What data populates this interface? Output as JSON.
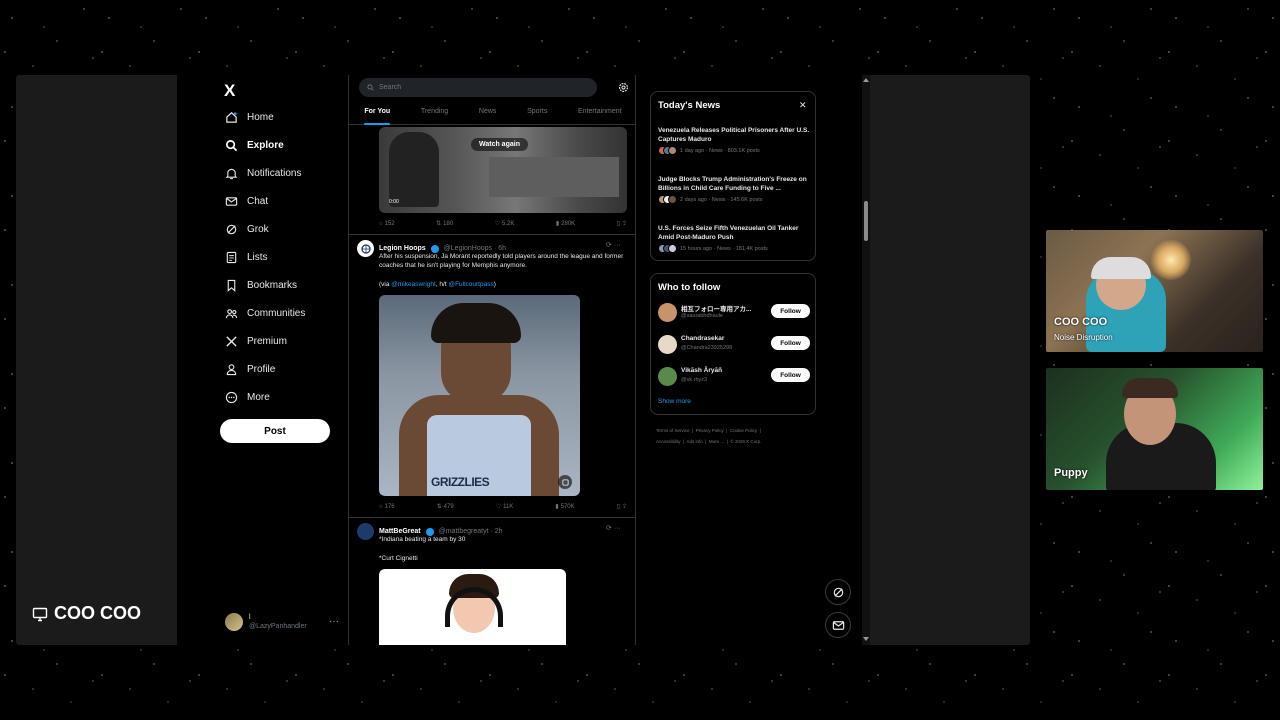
{
  "presenter": {
    "name": "COO COO"
  },
  "nav": {
    "logo": "X",
    "items": [
      {
        "label": "Home",
        "icon": "home-icon"
      },
      {
        "label": "Explore",
        "icon": "search-icon"
      },
      {
        "label": "Notifications",
        "icon": "bell-icon"
      },
      {
        "label": "Chat",
        "icon": "mail-icon"
      },
      {
        "label": "Grok",
        "icon": "grok-icon"
      },
      {
        "label": "Lists",
        "icon": "list-icon"
      },
      {
        "label": "Bookmarks",
        "icon": "bookmark-icon"
      },
      {
        "label": "Communities",
        "icon": "people-icon"
      },
      {
        "label": "Premium",
        "icon": "x-icon"
      },
      {
        "label": "Profile",
        "icon": "person-icon"
      },
      {
        "label": "More",
        "icon": "more-icon"
      }
    ],
    "active": "Explore",
    "post_label": "Post",
    "account": {
      "name": "l",
      "handle": "@LazyPanhandler"
    }
  },
  "feed": {
    "search_placeholder": "Search",
    "tabs": [
      "For You",
      "Trending",
      "News",
      "Sports",
      "Entertainment"
    ],
    "active_tab": "For You",
    "video": {
      "overlay": "Watch again",
      "timecode": "0:00"
    },
    "stats1": {
      "replies": "152",
      "reposts": "180",
      "likes": "5.2K",
      "views": "280K"
    },
    "tweet1": {
      "name": "Legion Hoops",
      "handle": "@LegionHoops · 6h",
      "text": "After his suspension, Ja Morant reportedly told players around the league and former coaches that he isn't playing for Memphis anymore.",
      "via_prefix": "(via ",
      "via_link1": "@mikeaswright",
      "via_mid": ", h/t ",
      "via_link2": "@Fullcourtpass",
      "via_suffix": ")",
      "jersey_text": "GRIZZLIES"
    },
    "stats2": {
      "replies": "176",
      "reposts": "479",
      "likes": "11K",
      "views": "570K"
    },
    "tweet2": {
      "name": "MattBeGreat",
      "handle": "@mattbegreatyt · 2h",
      "line1": "*Indiana beating a team by 30",
      "line2": "*Curt Cignetti"
    }
  },
  "news": {
    "title": "Today's News",
    "items": [
      {
        "headline": "Venezuela Releases Political Prisoners After U.S. Captures Maduro",
        "meta": "1 day ago · News · 803.1K posts"
      },
      {
        "headline": "Judge Blocks Trump Administration's Freeze on Billions in Child Care Funding to Five ...",
        "meta": "2 days ago · News · 145.6K posts"
      },
      {
        "headline": "U.S. Forces Seize Fifth Venezuelan Oil Tanker Amid Post-Maduro Push",
        "meta": "15 hours ago · News · 181.4K posts"
      }
    ]
  },
  "who_to_follow": {
    "title": "Who to follow",
    "accounts": [
      {
        "name": "相互フォロー専用アカ...",
        "handle": "@saurabhdhaule"
      },
      {
        "name": "Chandrasekar",
        "handle": "@Chandra23925298"
      },
      {
        "name": "Vikāsh Āryāñ",
        "handle": "@vk.rhyz3"
      }
    ],
    "follow_label": "Follow",
    "show_more": "Show more"
  },
  "footer": {
    "links": [
      "Terms of Service",
      "Privacy Policy",
      "Cookie Policy",
      "Accessibility",
      "Ads info",
      "More ...",
      "© 2026 X Corp."
    ]
  },
  "webcams": [
    {
      "name": "COO COO",
      "subtitle": "Noise Disruption"
    },
    {
      "name": "Puppy"
    }
  ],
  "colors": {
    "accent": "#1d9bf0",
    "background": "#000000",
    "border": "#2f3336",
    "muted": "#71767b"
  }
}
